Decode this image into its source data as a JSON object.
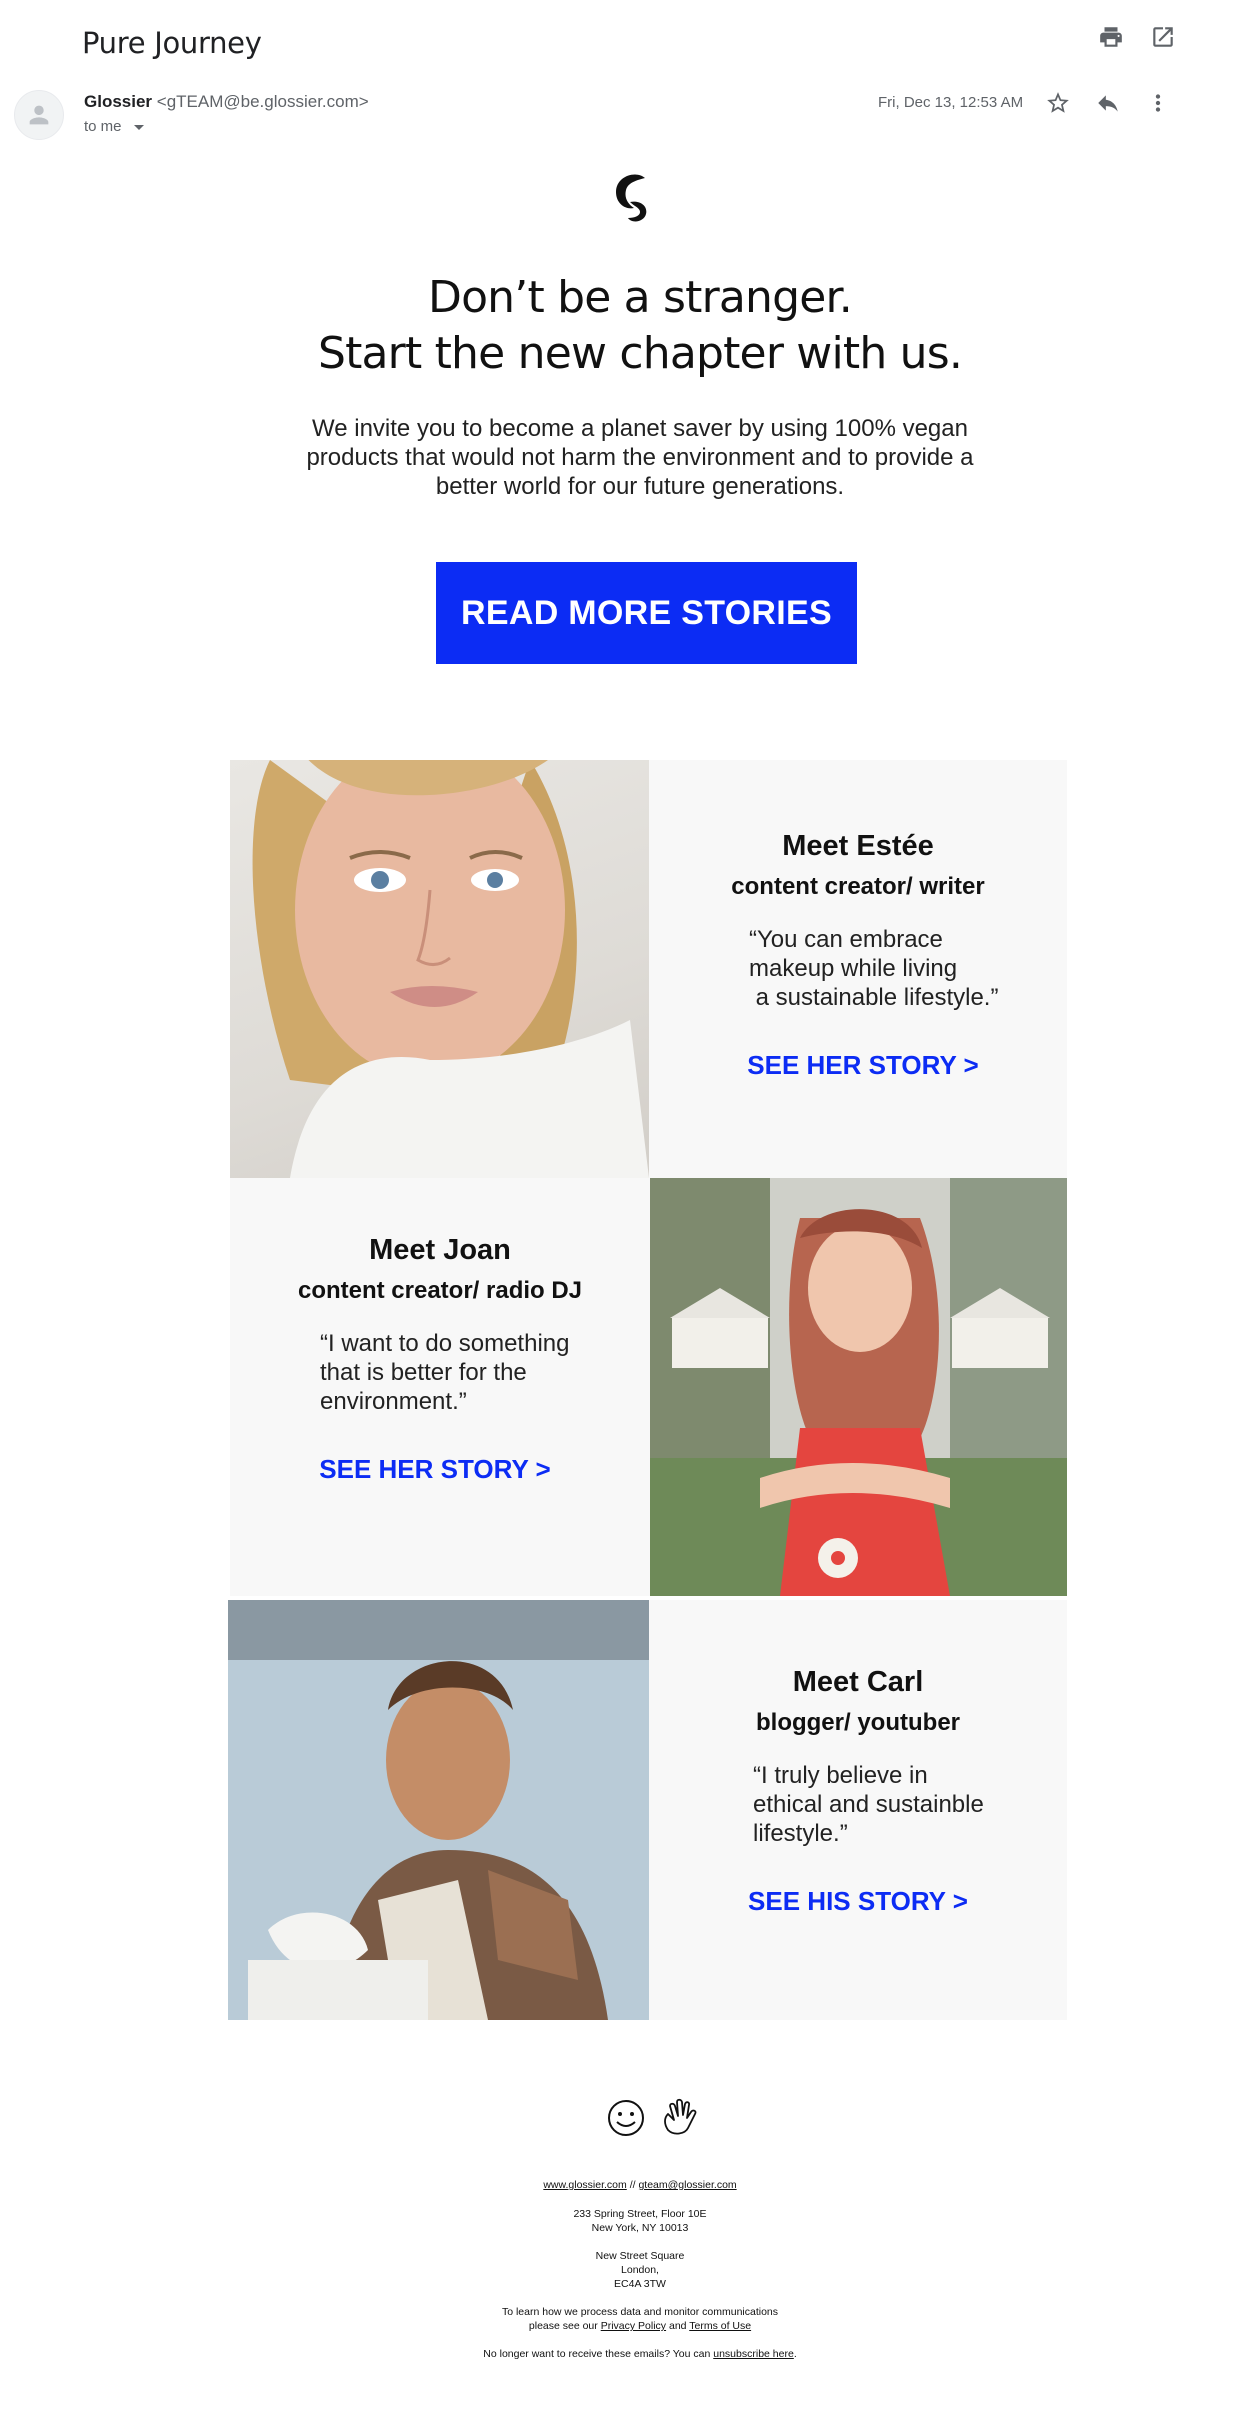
{
  "email": {
    "subject": "Pure Journey",
    "sender_name": "Glossier",
    "sender_email": "<gTEAM@be.glossier.com>",
    "to": "to me",
    "date": "Fri, Dec 13,  12:53 AM"
  },
  "icons": {
    "print": "print-icon",
    "open_new": "open-in-new-window-icon",
    "avatar": "person-avatar-icon",
    "star": "star-icon",
    "reply": "reply-icon",
    "more": "more-vert-icon"
  },
  "body": {
    "headline_line1": "Don’t be a stranger.",
    "headline_line2": "Start the new chapter with us.",
    "intro": "We invite you to become a planet saver by using 100% vegan products that would not harm the environment and to provide a better world for our future generations.",
    "cta_label": "READ MORE STORIES"
  },
  "stories": [
    {
      "name": "Meet Estée",
      "role": "content creator/ writer",
      "quote_lines": [
        "“You can embrace",
        "makeup while living",
        " a sustainable lifestyle.”"
      ],
      "link": "SEE HER STORY >"
    },
    {
      "name": "Meet Joan",
      "role": "content creator/ radio DJ",
      "quote_lines": [
        "“I want to do something",
        "that is better for the",
        "environment.”"
      ],
      "link": "SEE HER STORY >"
    },
    {
      "name": "Meet Carl",
      "role": "blogger/ youtuber",
      "quote_lines": [
        "“I truly believe in",
        "ethical and sustainble",
        "lifestyle.”"
      ],
      "link": "SEE HIS STORY >"
    }
  ],
  "footer": {
    "website": "www.glossier.com",
    "separator": " // ",
    "email": "gteam@glossier.com",
    "address_us_line1": "233 Spring Street, Floor 10E",
    "address_us_line2": "New York, NY 10013",
    "address_uk_line1": "New Street Square",
    "address_uk_line2": "London,",
    "address_uk_line3": "EC4A 3TW",
    "privacy_line1": "To learn how we process data and monitor communications",
    "privacy_line2_prefix": "please see our ",
    "privacy_link": "Privacy Policy",
    "privacy_and": " and ",
    "terms_link": "Terms of Use",
    "unsub_prefix": "No longer want to receive these emails? You can ",
    "unsub_link": "unsubscribe here",
    "unsub_suffix": "."
  },
  "colors": {
    "accent_blue": "#0c2cf4",
    "panel_bg": "#f8f8f8",
    "text_dark": "#111111",
    "gmail_gray": "#5f6368"
  }
}
